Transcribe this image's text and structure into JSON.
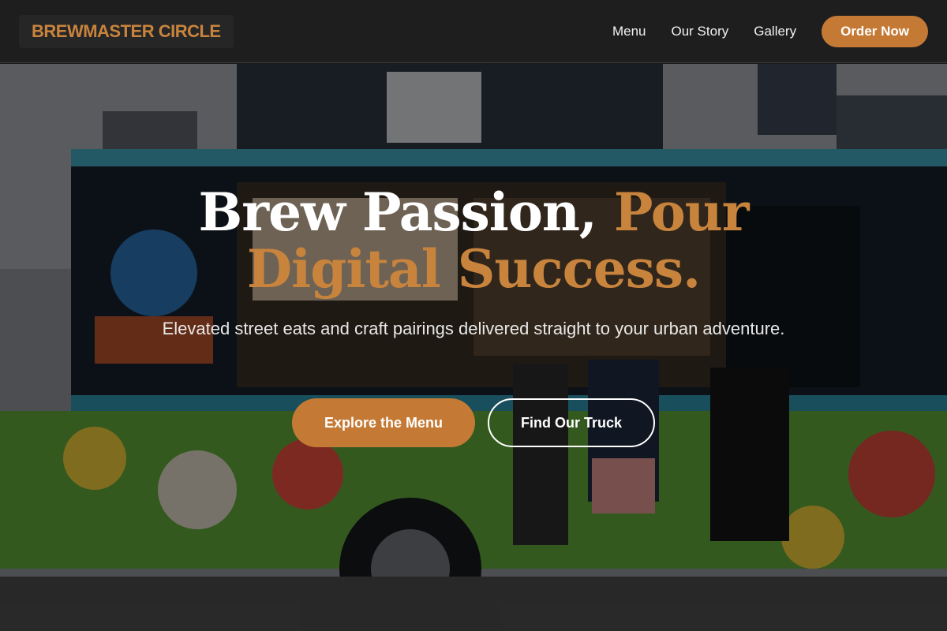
{
  "header": {
    "logo": "BREWMASTER CIRCLE",
    "nav": [
      {
        "label": "Menu"
      },
      {
        "label": "Our Story"
      },
      {
        "label": "Gallery"
      }
    ],
    "cta": "Order Now"
  },
  "hero": {
    "headline_white": "Brew Passion,",
    "headline_accent_1": "Pour",
    "headline_accent_2": "Digital Success.",
    "subtitle": "Elevated street eats and craft pairings delivered straight to your urban adventure.",
    "primary_button": "Explore the Menu",
    "secondary_button": "Find Our Truck",
    "background_image": "food-truck-photo"
  },
  "colors": {
    "accent": "#c47a35",
    "header_bg": "#1e1e1e",
    "text": "#ffffff"
  }
}
